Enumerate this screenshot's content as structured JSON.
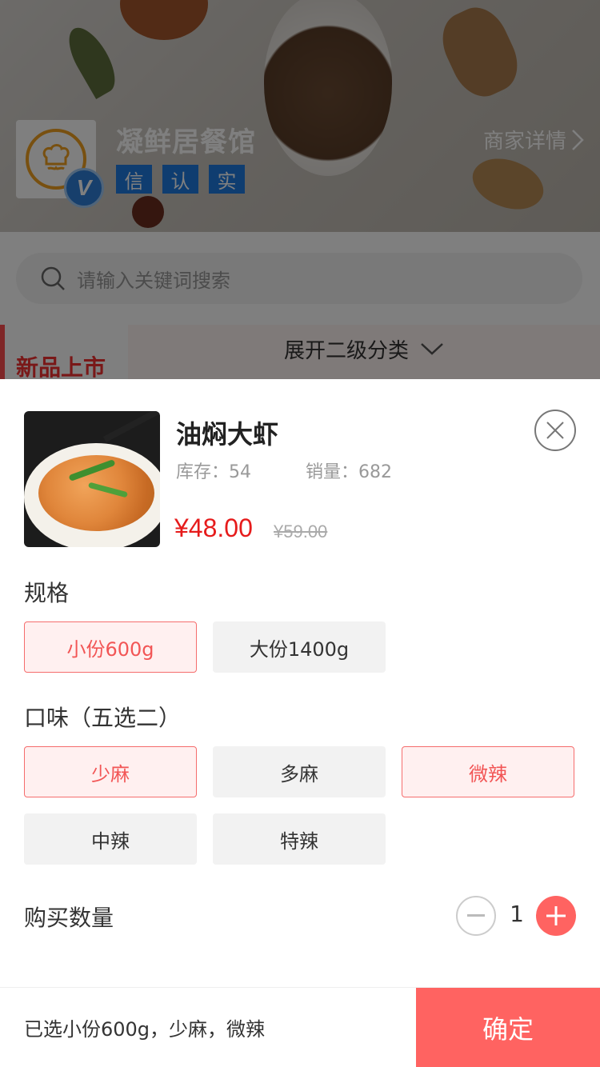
{
  "store": {
    "name": "凝鲜居餐馆",
    "tags": [
      "信",
      "认",
      "实"
    ],
    "detail_link": "商家详情",
    "badge": "V"
  },
  "search": {
    "placeholder": "请输入关键词搜索"
  },
  "category": {
    "active": "新品上市",
    "expand": "展开二级分类"
  },
  "product": {
    "name": "油焖大虾",
    "stock_label": "库存：54",
    "sales_label": "销量：682",
    "price": "¥48.00",
    "original_price": "¥59.00"
  },
  "spec": {
    "title": "规格",
    "options": [
      {
        "label": "小份600g",
        "selected": true
      },
      {
        "label": "大份1400g",
        "selected": false
      }
    ]
  },
  "flavor": {
    "title": "口味（五选二）",
    "options": [
      {
        "label": "少麻",
        "selected": true
      },
      {
        "label": "多麻",
        "selected": false
      },
      {
        "label": "微辣",
        "selected": true
      },
      {
        "label": "中辣",
        "selected": false
      },
      {
        "label": "特辣",
        "selected": false
      }
    ]
  },
  "quantity": {
    "label": "购买数量",
    "value": "1"
  },
  "footer": {
    "summary": "已选小份600g，少麻，微辣",
    "confirm": "确定"
  },
  "colors": {
    "accent": "#ff6361",
    "price": "#e61b1b",
    "tag": "#1f7ae0"
  },
  "icons": [
    "chef-logo-icon",
    "verified-v-icon",
    "chevron-right-icon",
    "search-icon",
    "chevron-down-icon",
    "close-icon",
    "minus-icon",
    "plus-icon"
  ]
}
